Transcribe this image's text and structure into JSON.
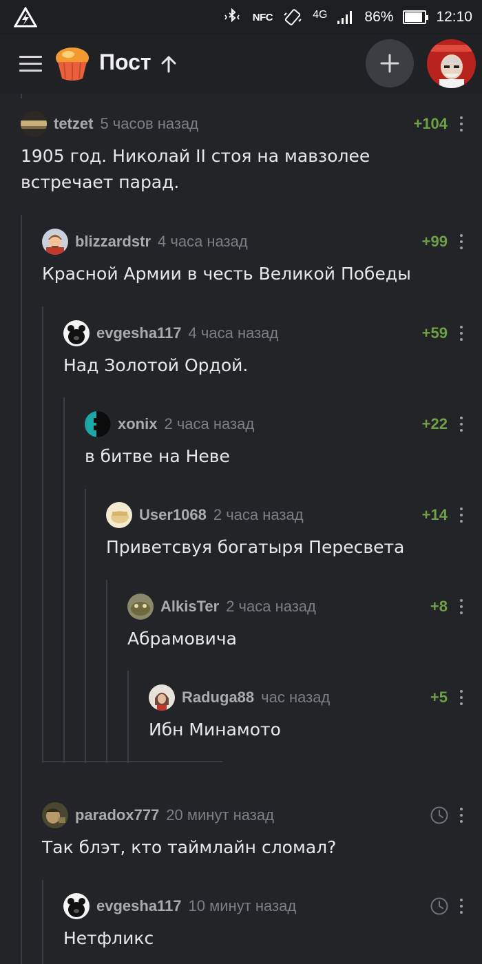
{
  "status_bar": {
    "nfc": "NFC",
    "network": "4G",
    "battery": "86%",
    "battery_level": 0.86,
    "time": "12:10",
    "icons": [
      "app-logo-icon",
      "bluetooth-icon",
      "vibrate-icon",
      "signal-icon",
      "battery-icon"
    ]
  },
  "top_bar": {
    "title": "Пост",
    "icons": [
      "hamburger-menu-icon",
      "cupcake-logo-icon",
      "up-arrow-icon",
      "plus-icon"
    ]
  },
  "comments": [
    {
      "user": "tetzet",
      "time": "5 часов назад",
      "rating": "+104",
      "text": "1905 год. Николай II стоя на мавзолее встречает парад."
    },
    {
      "user": "blizzardstr",
      "time": "4 часа назад",
      "rating": "+99",
      "text": "Красной Армии в честь Великой Победы"
    },
    {
      "user": "evgesha117",
      "time": "4 часа назад",
      "rating": "+59",
      "text": "Над Золотой Ордой."
    },
    {
      "user": "xonix",
      "time": "2 часа назад",
      "rating": "+22",
      "text": "в битве на Неве"
    },
    {
      "user": "User1068",
      "time": "2 часа назад",
      "rating": "+14",
      "text": "Приветсвуя богатыря Пересвета"
    },
    {
      "user": "AlkisTer",
      "time": "2 часа назад",
      "rating": "+8",
      "text": "Абрамовича"
    },
    {
      "user": "Raduga88",
      "time": "час назад",
      "rating": "+5",
      "text": "Ибн Минамото"
    },
    {
      "user": "paradox777",
      "time": "20 минут назад",
      "rating": "",
      "text": "Так блэт, кто таймлайн сломал?"
    },
    {
      "user": "evgesha117",
      "time": "10 минут назад",
      "rating": "",
      "text": "Нетфликс"
    }
  ],
  "colors": {
    "background": "#222427",
    "rating_positive": "#6ea145",
    "username": "#a9acaf",
    "timestamp": "#7c7f83"
  }
}
